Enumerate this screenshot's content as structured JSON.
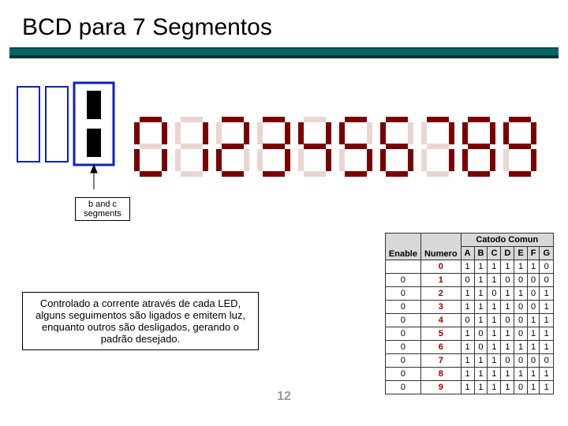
{
  "title": "BCD para 7 Segmentos",
  "bc_label": "b and c segments",
  "caption": "Controlado a corrente através de cada LED, alguns seguimentos são ligados e emitem luz, enquanto outros são desligados, gerando o padrão desejado.",
  "page_number": "12",
  "table": {
    "header_group": "Catodo Comun",
    "head_numero": "Numero",
    "head_enable": "Enable",
    "columns": [
      "A",
      "B",
      "C",
      "D",
      "E",
      "F",
      "G"
    ],
    "enable_values": [
      "",
      "0",
      "0",
      "0",
      "0",
      "0",
      "0",
      "0",
      "0",
      "0"
    ],
    "rows": [
      {
        "num": "0",
        "bits": [
          "1",
          "1",
          "1",
          "1",
          "1",
          "1",
          "0"
        ]
      },
      {
        "num": "1",
        "bits": [
          "0",
          "1",
          "1",
          "0",
          "0",
          "0",
          "0"
        ]
      },
      {
        "num": "2",
        "bits": [
          "1",
          "1",
          "0",
          "1",
          "1",
          "0",
          "1"
        ]
      },
      {
        "num": "3",
        "bits": [
          "1",
          "1",
          "1",
          "1",
          "0",
          "0",
          "1"
        ]
      },
      {
        "num": "4",
        "bits": [
          "0",
          "1",
          "1",
          "0",
          "0",
          "1",
          "1"
        ]
      },
      {
        "num": "5",
        "bits": [
          "1",
          "0",
          "1",
          "1",
          "0",
          "1",
          "1"
        ]
      },
      {
        "num": "6",
        "bits": [
          "1",
          "0",
          "1",
          "1",
          "1",
          "1",
          "1"
        ]
      },
      {
        "num": "7",
        "bits": [
          "1",
          "1",
          "1",
          "0",
          "0",
          "0",
          "0"
        ]
      },
      {
        "num": "8",
        "bits": [
          "1",
          "1",
          "1",
          "1",
          "1",
          "1",
          "1"
        ]
      },
      {
        "num": "9",
        "bits": [
          "1",
          "1",
          "1",
          "1",
          "0",
          "1",
          "1"
        ]
      }
    ]
  },
  "digits": [
    {
      "on": [
        "a",
        "b",
        "c",
        "d",
        "e",
        "f"
      ]
    },
    {
      "on": [
        "b",
        "c"
      ]
    },
    {
      "on": [
        "a",
        "b",
        "d",
        "e",
        "g"
      ]
    },
    {
      "on": [
        "a",
        "b",
        "c",
        "d",
        "g"
      ]
    },
    {
      "on": [
        "b",
        "c",
        "f",
        "g"
      ]
    },
    {
      "on": [
        "a",
        "c",
        "d",
        "f",
        "g"
      ]
    },
    {
      "on": [
        "a",
        "c",
        "d",
        "e",
        "f",
        "g"
      ]
    },
    {
      "on": [
        "a",
        "b",
        "c"
      ]
    },
    {
      "on": [
        "a",
        "b",
        "c",
        "d",
        "e",
        "f",
        "g"
      ]
    },
    {
      "on": [
        "a",
        "b",
        "c",
        "d",
        "f",
        "g"
      ]
    }
  ]
}
